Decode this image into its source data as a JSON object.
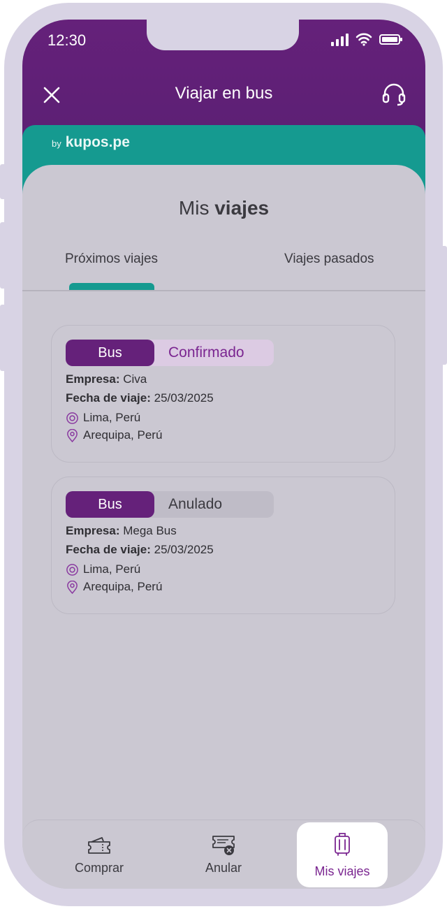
{
  "status_bar": {
    "time": "12:30"
  },
  "header": {
    "title": "Viajar en bus"
  },
  "brand": {
    "by": "by",
    "name": "kupos.pe"
  },
  "page": {
    "title_regular": "Mis",
    "title_bold": "viajes"
  },
  "tabs": [
    {
      "label": "Próximos viajes",
      "active": true
    },
    {
      "label": "Viajes pasados",
      "active": false
    }
  ],
  "trips": [
    {
      "mode": "Bus",
      "status": "Confirmado",
      "company_label": "Empresa:",
      "company": "Civa",
      "date_label": "Fecha de viaje:",
      "date": "25/03/2025",
      "origin": "Lima, Perú",
      "destination": "Arequipa, Perú"
    },
    {
      "mode": "Bus",
      "status": "Anulado",
      "company_label": "Empresa:",
      "company": "Mega Bus",
      "date_label": "Fecha de viaje:",
      "date": "25/03/2025",
      "origin": "Lima, Perú",
      "destination": "Arequipa, Perú"
    }
  ],
  "bottom_nav": [
    {
      "label": "Comprar",
      "icon": "ticket-icon",
      "active": false
    },
    {
      "label": "Anular",
      "icon": "cancel-ticket-icon",
      "active": false
    },
    {
      "label": "Mis viajes",
      "icon": "luggage-icon",
      "active": true
    }
  ],
  "colors": {
    "primary_purple": "#65217a",
    "teal": "#159a90",
    "status_confirmed_bg": "#dccbe3",
    "status_confirmed_text": "#7a2590",
    "status_cancelled_bg": "#bfbcc7",
    "status_cancelled_text": "#3b3a40"
  }
}
